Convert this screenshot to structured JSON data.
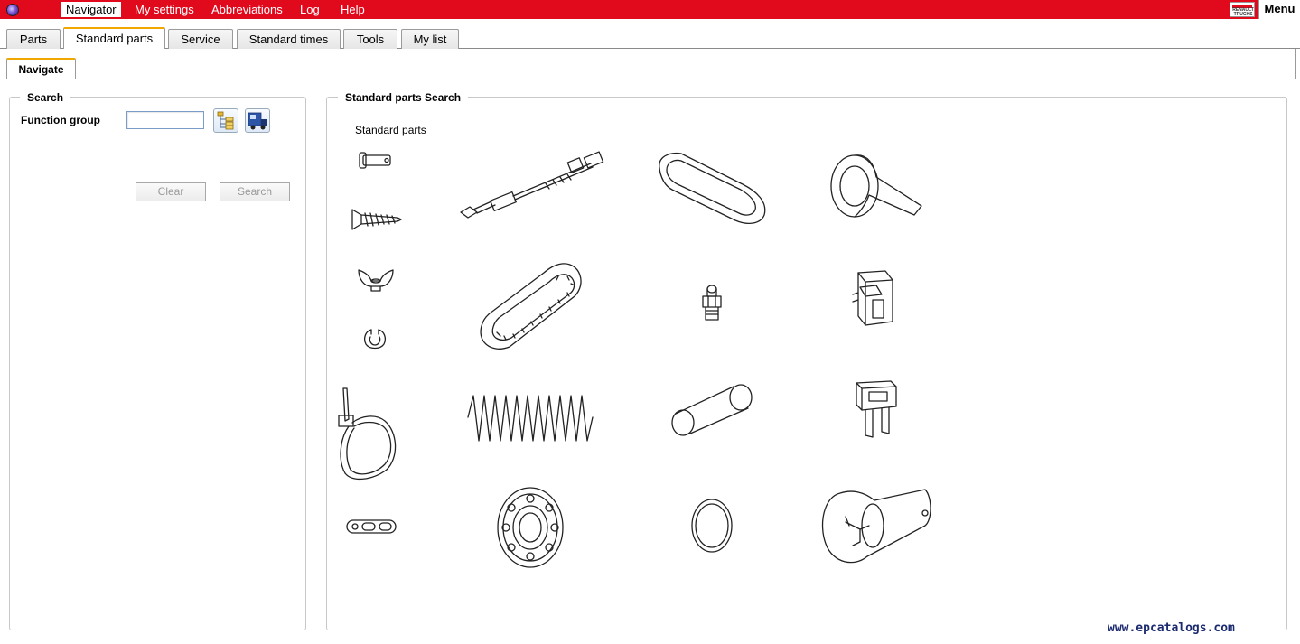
{
  "menubar": {
    "items": [
      "Navigator",
      "My settings",
      "Abbreviations",
      "Log",
      "Help"
    ],
    "active": "Navigator",
    "brand_text": "RENAULT TRUCKS",
    "menu_label": "Menu",
    "color": "#e10a1d"
  },
  "main_tabs": [
    "Parts",
    "Standard parts",
    "Service",
    "Standard times",
    "Tools",
    "My list"
  ],
  "active_main_tab": "Standard parts",
  "sub_tabs": [
    "Navigate"
  ],
  "search_panel": {
    "legend": "Search",
    "function_group_label": "Function group",
    "function_group_value": "",
    "tree_icon": "tree-structure-icon",
    "truck_icon": "truck-icon",
    "clear_label": "Clear",
    "search_label": "Search"
  },
  "results_panel": {
    "legend": "Standard parts Search",
    "group_label": "Standard parts",
    "parts": [
      "clevis-pin-icon",
      "threaded-rod-icon",
      "flat-belt-icon",
      "tape-roll-icon",
      "screw-icon",
      "wing-nut-icon",
      "toothed-belt-icon",
      "grease-nipple-icon",
      "switch-icon",
      "circlip-icon",
      "cable-tie-icon",
      "spring-icon",
      "tube-icon",
      "fuse-icon",
      "multi-hole-clip-icon",
      "ball-bearing-icon",
      "o-ring-icon",
      "bulb-icon"
    ]
  },
  "watermark": "www.epcatalogs.com"
}
